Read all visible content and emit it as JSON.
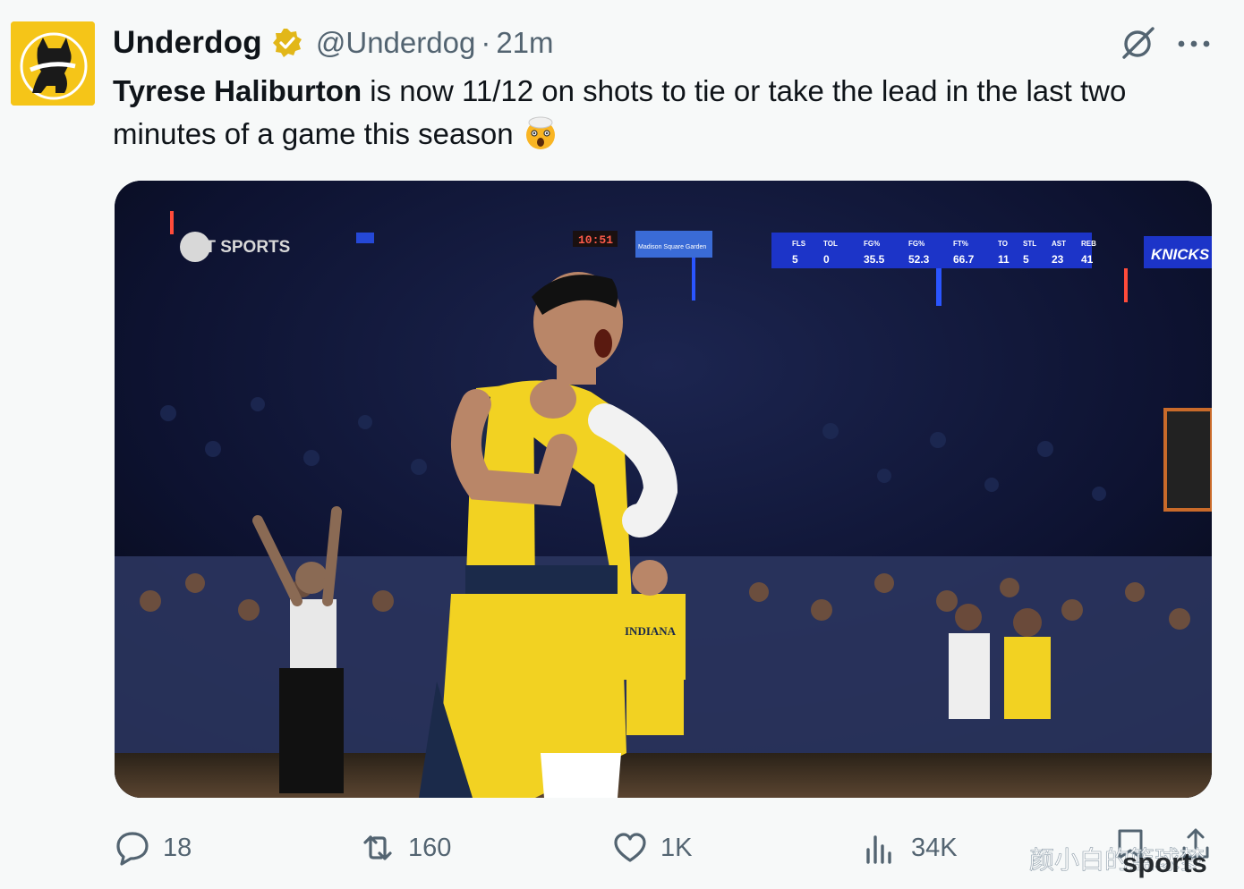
{
  "author": {
    "display_name": "Underdog",
    "handle": "@Underdog",
    "separator": "·",
    "time": "21m",
    "verified": true
  },
  "tweet": {
    "mention": "Tyrese Haliburton",
    "text_after": " is now 11/12 on shots to tie or take the lead in the last two minutes of a game this season",
    "emoji": "shocked-face-emoji"
  },
  "media": {
    "broadcaster": "TNT SPORTS",
    "game_clock": "10:51",
    "arena_banner_left": "Madison Square Garden",
    "team_banner": "KNICKS",
    "stats_headers": [
      "FLS",
      "TOL",
      "FG%",
      "FG%",
      "FT%",
      "TO",
      "STL",
      "AST",
      "REB"
    ],
    "stats_values": [
      "5",
      "0",
      "35.5",
      "52.3",
      "66.7",
      "11",
      "5",
      "23",
      "41"
    ],
    "player_jersey": "INDIANA"
  },
  "actions": {
    "replies": "18",
    "retweets": "160",
    "likes": "1K",
    "views": "34K"
  },
  "watermark": {
    "cn_text": "颜小白的篮球梦",
    "en_text": "sports"
  },
  "colors": {
    "brand_yellow": "#f5c518",
    "verified_gold": "#e2b719",
    "muted_text": "#536471",
    "pacers_yellow": "#f2d222",
    "pacers_navy": "#1b2a4a"
  }
}
